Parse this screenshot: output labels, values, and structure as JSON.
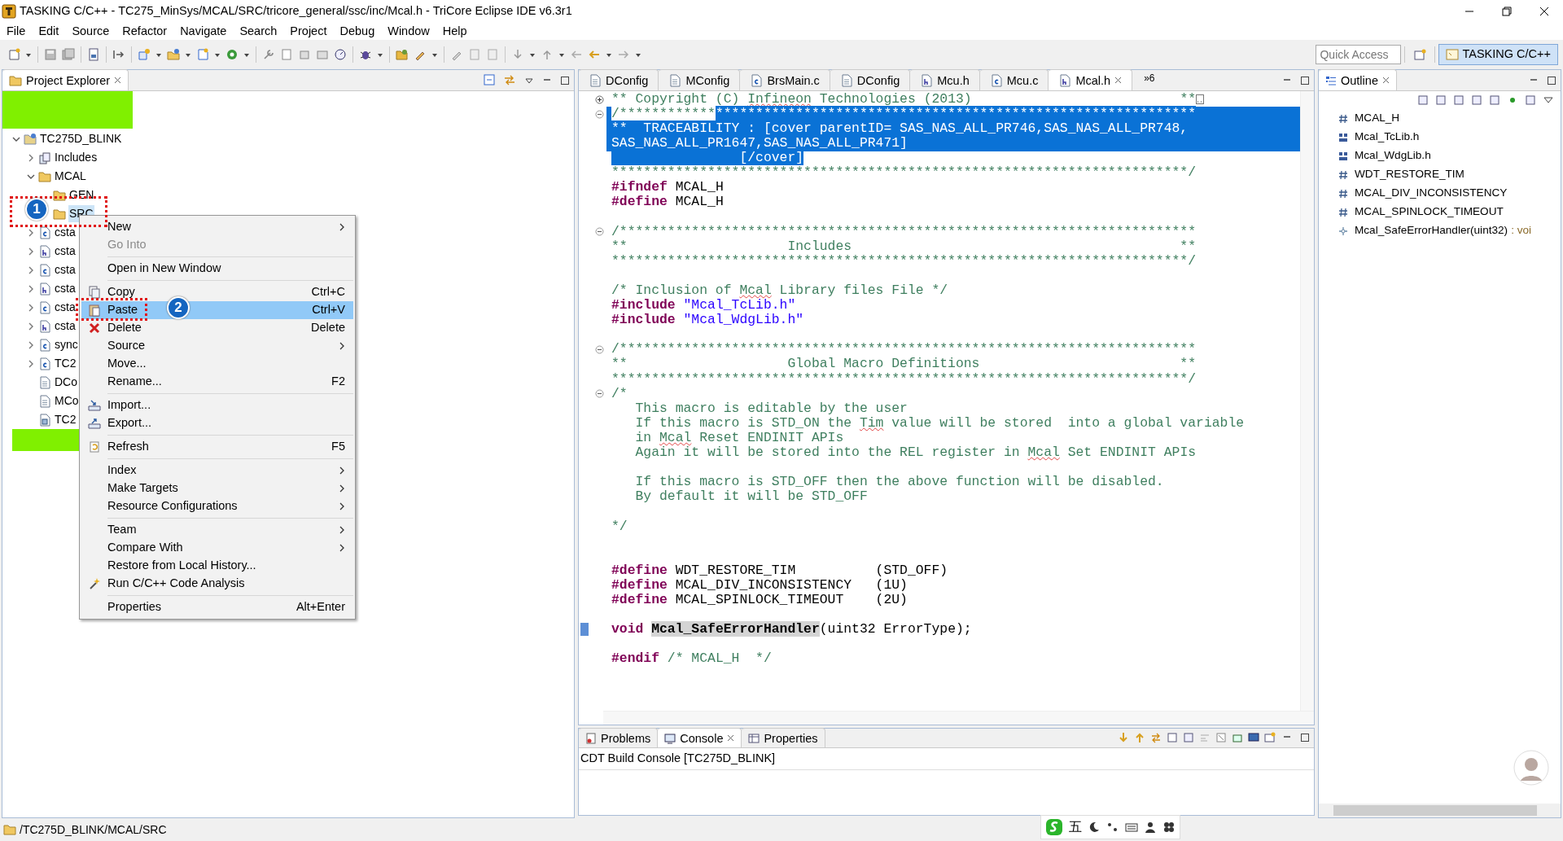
{
  "window": {
    "title": "TASKING C/C++ - TC275_MinSys/MCAL/SRC/tricore_general/ssc/inc/Mcal.h - TriCore Eclipse IDE v6.3r1"
  },
  "menu_bar": [
    "File",
    "Edit",
    "Source",
    "Refactor",
    "Navigate",
    "Search",
    "Project",
    "Debug",
    "Window",
    "Help"
  ],
  "quick_access": {
    "placeholder": "Quick Access"
  },
  "perspective": {
    "label": "TASKING C/C++",
    "selected": true
  },
  "explorer": {
    "title": "Project Explorer",
    "tree": [
      {
        "label": "TC275D_BLINK",
        "kind": "project",
        "expanded": true,
        "selected": false,
        "children": [
          {
            "label": "Includes",
            "kind": "includes",
            "expanded": false,
            "selected": false
          },
          {
            "label": "MCAL",
            "kind": "folder",
            "expanded": true,
            "selected": false,
            "children": [
              {
                "label": "GEN",
                "kind": "folder",
                "selected": false
              },
              {
                "label": "SRC",
                "kind": "folder",
                "selected": true
              }
            ]
          },
          {
            "label": "csta",
            "kind": "c-file",
            "expanded": false,
            "selected": false
          },
          {
            "label": "csta",
            "kind": "h-file",
            "expanded": false,
            "selected": false
          },
          {
            "label": "csta",
            "kind": "c-file",
            "expanded": false,
            "selected": false
          },
          {
            "label": "csta",
            "kind": "h-file",
            "expanded": false,
            "selected": false
          },
          {
            "label": "csta",
            "kind": "c-file",
            "expanded": false,
            "selected": false
          },
          {
            "label": "csta",
            "kind": "h-file",
            "expanded": false,
            "selected": false
          },
          {
            "label": "sync",
            "kind": "c-file",
            "expanded": false,
            "selected": false
          },
          {
            "label": "TC2",
            "kind": "c-file",
            "expanded": false,
            "selected": false
          },
          {
            "label": "DCo",
            "kind": "doc-file",
            "selected": false
          },
          {
            "label": "MCo",
            "kind": "doc-file",
            "selected": false
          },
          {
            "label": "TC2",
            "kind": "linker-file",
            "selected": false
          }
        ]
      }
    ]
  },
  "context_menu": [
    {
      "kind": "plain",
      "label": "New",
      "submenu": true,
      "disabled": false,
      "selected": false
    },
    {
      "kind": "plain",
      "label": "Go Into",
      "submenu": false,
      "disabled": true,
      "selected": false
    },
    {
      "kind": "separator"
    },
    {
      "kind": "plain",
      "label": "Open in New Window",
      "submenu": false,
      "disabled": false,
      "selected": false
    },
    {
      "kind": "separator"
    },
    {
      "kind": "copy",
      "label": "Copy",
      "shortcut": "Ctrl+C",
      "submenu": false,
      "disabled": false,
      "selected": false
    },
    {
      "kind": "paste",
      "label": "Paste",
      "shortcut": "Ctrl+V",
      "submenu": false,
      "disabled": false,
      "selected": true
    },
    {
      "kind": "delete",
      "label": "Delete",
      "shortcut": "Delete",
      "submenu": false,
      "disabled": false,
      "selected": false
    },
    {
      "kind": "plain",
      "label": "Source",
      "submenu": true,
      "disabled": false,
      "selected": false
    },
    {
      "kind": "plain",
      "label": "Move...",
      "submenu": false,
      "disabled": false,
      "selected": false
    },
    {
      "kind": "plain",
      "label": "Rename...",
      "shortcut": "F2",
      "submenu": false,
      "disabled": false,
      "selected": false
    },
    {
      "kind": "separator"
    },
    {
      "kind": "import",
      "label": "Import...",
      "submenu": false,
      "disabled": false,
      "selected": false
    },
    {
      "kind": "export",
      "label": "Export...",
      "submenu": false,
      "disabled": false,
      "selected": false
    },
    {
      "kind": "separator"
    },
    {
      "kind": "refresh",
      "label": "Refresh",
      "shortcut": "F5",
      "submenu": false,
      "disabled": false,
      "selected": false
    },
    {
      "kind": "separator"
    },
    {
      "kind": "plain",
      "label": "Index",
      "submenu": true,
      "disabled": false,
      "selected": false
    },
    {
      "kind": "plain",
      "label": "Make Targets",
      "submenu": true,
      "disabled": false,
      "selected": false
    },
    {
      "kind": "plain",
      "label": "Resource Configurations",
      "submenu": true,
      "disabled": false,
      "selected": false
    },
    {
      "kind": "separator"
    },
    {
      "kind": "plain",
      "label": "Team",
      "submenu": true,
      "disabled": false,
      "selected": false
    },
    {
      "kind": "plain",
      "label": "Compare With",
      "submenu": true,
      "disabled": false,
      "selected": false
    },
    {
      "kind": "plain",
      "label": "Restore from Local History...",
      "submenu": false,
      "disabled": false,
      "selected": false
    },
    {
      "kind": "analysis",
      "label": "Run C/C++ Code Analysis",
      "submenu": false,
      "disabled": false,
      "selected": false
    },
    {
      "kind": "separator"
    },
    {
      "kind": "plain",
      "label": "Properties",
      "shortcut": "Alt+Enter",
      "submenu": false,
      "disabled": false,
      "selected": false
    }
  ],
  "annotations": [
    {
      "number": "1"
    },
    {
      "number": "2"
    }
  ],
  "editor": {
    "tabs": [
      {
        "label": "DConfig",
        "kind": "doc-file",
        "selected": false
      },
      {
        "label": "MConfig",
        "kind": "doc-file",
        "selected": false
      },
      {
        "label": "BrsMain.c",
        "kind": "c-file",
        "selected": false
      },
      {
        "label": "DConfig",
        "kind": "doc-file",
        "selected": false
      },
      {
        "label": "Mcu.h",
        "kind": "h-file",
        "selected": false
      },
      {
        "label": "Mcu.c",
        "kind": "c-file",
        "selected": false
      },
      {
        "label": "Mcal.h",
        "kind": "h-file",
        "selected": true
      }
    ],
    "overflow": "»6",
    "lines": [
      {
        "kind": "code",
        "folded": true,
        "folded_box": true,
        "segments": [
          {
            "text": "** Copyright (C) ",
            "kind": "comment"
          },
          {
            "text": "Infineon",
            "kind": "comment",
            "misspelled": true
          },
          {
            "text": " Technologies (2013)                          **",
            "kind": "comment"
          }
        ]
      },
      {
        "kind": "code",
        "folded": false,
        "eol_selected": true,
        "segments": [
          {
            "text": "/************",
            "kind": "comment",
            "selected": false
          },
          {
            "text": "************************************************************",
            "kind": "comment",
            "selected": true
          }
        ]
      },
      {
        "kind": "code",
        "eol_selected": true,
        "segments": [
          {
            "text": "**  TRACEABILITY : [cover parentID= SAS_NAS_ALL_PR746,SAS_NAS_ALL_PR748,",
            "kind": "comment",
            "selected": true
          }
        ]
      },
      {
        "kind": "code",
        "eol_selected": true,
        "segments": [
          {
            "text": "SAS_NAS_ALL_PR1647,SAS_NAS_ALL_PR471]",
            "kind": "comment",
            "selected": true
          }
        ]
      },
      {
        "kind": "code",
        "segments": [
          {
            "text": "                [/cover]",
            "kind": "comment",
            "selected": true
          }
        ]
      },
      {
        "kind": "code",
        "segments": [
          {
            "text": "************************************************************************/",
            "kind": "comment"
          }
        ]
      },
      {
        "kind": "code",
        "segments": [
          {
            "text": "#ifndef",
            "kind": "keyword"
          },
          {
            "text": " MCAL_H",
            "kind": "plain"
          }
        ]
      },
      {
        "kind": "code",
        "segments": [
          {
            "text": "#define",
            "kind": "keyword"
          },
          {
            "text": " MCAL_H",
            "kind": "plain"
          }
        ]
      },
      {
        "kind": "blank"
      },
      {
        "kind": "code",
        "folded": false,
        "segments": [
          {
            "text": "/************************************************************************",
            "kind": "comment"
          }
        ]
      },
      {
        "kind": "code",
        "segments": [
          {
            "text": "**                    Includes                                         **",
            "kind": "comment"
          }
        ]
      },
      {
        "kind": "code",
        "segments": [
          {
            "text": "************************************************************************/",
            "kind": "comment"
          }
        ]
      },
      {
        "kind": "blank"
      },
      {
        "kind": "code",
        "segments": [
          {
            "text": "/* Inclusion of ",
            "kind": "comment"
          },
          {
            "text": "Mcal",
            "kind": "comment",
            "misspelled": true
          },
          {
            "text": " Library files File */",
            "kind": "comment"
          }
        ]
      },
      {
        "kind": "code",
        "segments": [
          {
            "text": "#include ",
            "kind": "keyword"
          },
          {
            "text": "\"Mcal_TcLib.h\"",
            "kind": "string"
          }
        ]
      },
      {
        "kind": "code",
        "segments": [
          {
            "text": "#include ",
            "kind": "keyword"
          },
          {
            "text": "\"Mcal_WdgLib.h\"",
            "kind": "string"
          }
        ]
      },
      {
        "kind": "blank"
      },
      {
        "kind": "code",
        "folded": false,
        "segments": [
          {
            "text": "/************************************************************************",
            "kind": "comment"
          }
        ]
      },
      {
        "kind": "code",
        "segments": [
          {
            "text": "**                    Global Macro Definitions                         **",
            "kind": "comment"
          }
        ]
      },
      {
        "kind": "code",
        "segments": [
          {
            "text": "************************************************************************/",
            "kind": "comment"
          }
        ]
      },
      {
        "kind": "code",
        "folded": false,
        "segments": [
          {
            "text": "/*",
            "kind": "comment"
          }
        ]
      },
      {
        "kind": "code",
        "segments": [
          {
            "text": "   This macro is editable by the user",
            "kind": "comment"
          }
        ]
      },
      {
        "kind": "code",
        "segments": [
          {
            "text": "   If this macro is STD_ON the ",
            "kind": "comment"
          },
          {
            "text": "Tim",
            "kind": "comment",
            "misspelled": true
          },
          {
            "text": " value will be stored  into a global variable",
            "kind": "comment"
          }
        ]
      },
      {
        "kind": "code",
        "segments": [
          {
            "text": "   in ",
            "kind": "comment"
          },
          {
            "text": "Mcal",
            "kind": "comment",
            "misspelled": true
          },
          {
            "text": " Reset ENDINIT APIs",
            "kind": "comment"
          }
        ]
      },
      {
        "kind": "code",
        "segments": [
          {
            "text": "   Again it will be stored into the REL register in ",
            "kind": "comment"
          },
          {
            "text": "Mcal",
            "kind": "comment",
            "misspelled": true
          },
          {
            "text": " Set ENDINIT APIs",
            "kind": "comment"
          }
        ]
      },
      {
        "kind": "blank"
      },
      {
        "kind": "code",
        "segments": [
          {
            "text": "   If this macro is STD_OFF then the above function will be disabled.",
            "kind": "comment"
          }
        ]
      },
      {
        "kind": "code",
        "segments": [
          {
            "text": "   By default it will be STD_OFF",
            "kind": "comment"
          }
        ]
      },
      {
        "kind": "blank"
      },
      {
        "kind": "code",
        "segments": [
          {
            "text": "*/",
            "kind": "comment"
          }
        ]
      },
      {
        "kind": "blank"
      },
      {
        "kind": "blank"
      },
      {
        "kind": "code",
        "segments": [
          {
            "text": "#define",
            "kind": "keyword"
          },
          {
            "text": " WDT_RESTORE_TIM          (STD_OFF)",
            "kind": "plain"
          }
        ]
      },
      {
        "kind": "code",
        "segments": [
          {
            "text": "#define",
            "kind": "keyword"
          },
          {
            "text": " MCAL_DIV_INCONSISTENCY   (1U)",
            "kind": "plain"
          }
        ]
      },
      {
        "kind": "code",
        "segments": [
          {
            "text": "#define",
            "kind": "keyword"
          },
          {
            "text": " MCAL_SPINLOCK_TIMEOUT    (2U)",
            "kind": "plain"
          }
        ]
      },
      {
        "kind": "blank"
      },
      {
        "kind": "code",
        "ruler_mark": true,
        "segments": [
          {
            "text": "void ",
            "kind": "keyword"
          },
          {
            "text": "Mcal_SafeErrorHandler",
            "kind": "occurrence"
          },
          {
            "text": "(uint32 ErrorType);",
            "kind": "plain"
          }
        ]
      },
      {
        "kind": "blank"
      },
      {
        "kind": "code",
        "segments": [
          {
            "text": "#endif ",
            "kind": "keyword"
          },
          {
            "text": "/* MCAL_H  */",
            "kind": "comment"
          }
        ]
      }
    ]
  },
  "outline": {
    "title": "Outline",
    "items": [
      {
        "label": "MCAL_H",
        "kind": "macro"
      },
      {
        "label": "Mcal_TcLib.h",
        "kind": "include"
      },
      {
        "label": "Mcal_WdgLib.h",
        "kind": "include"
      },
      {
        "label": "WDT_RESTORE_TIM",
        "kind": "macro"
      },
      {
        "label": "MCAL_DIV_INCONSISTENCY",
        "kind": "macro"
      },
      {
        "label": "MCAL_SPINLOCK_TIMEOUT",
        "kind": "macro"
      },
      {
        "label": "Mcal_SafeErrorHandler(uint32)",
        "kind": "function",
        "type": ": voi"
      }
    ]
  },
  "console": {
    "tabs": [
      {
        "label": "Problems",
        "selected": false
      },
      {
        "label": "Console",
        "selected": true
      },
      {
        "label": "Properties",
        "selected": false
      }
    ],
    "title": "CDT Build Console [TC275D_BLINK]"
  },
  "status_bar": {
    "path": "/TC275D_BLINK/MCAL/SRC"
  },
  "ime_bar": {
    "mode": "五"
  }
}
